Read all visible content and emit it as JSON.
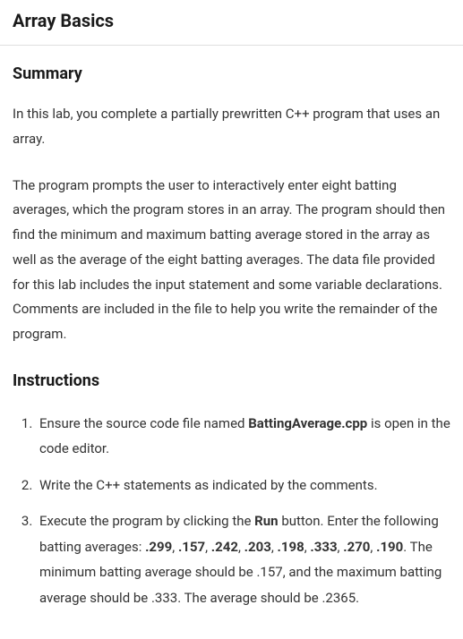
{
  "title": "Array Basics",
  "summary": {
    "heading": "Summary",
    "para1": "In this lab, you complete a partially prewritten C++ program that uses an array.",
    "para2": "The program prompts the user to interactively enter eight batting averages, which the program stores in an array. The program should then find the minimum and maximum batting average stored in the array as well as the average of the eight batting averages. The data file provided for this lab includes the input statement and some variable declarations. Comments are included in the file to help you write the remainder of the program."
  },
  "instructions": {
    "heading": "Instructions",
    "items": [
      {
        "pre": "Ensure the source code file named ",
        "bold1": "BattingAverage.cpp",
        "post": " is open in the code editor."
      },
      {
        "text": "Write the C++ statements as indicated by the comments."
      },
      {
        "pre": "Execute the program by clicking the ",
        "bold_run": "Run",
        "mid1": " button. Enter the following batting averages: ",
        "v1": ".299",
        "c": ", ",
        "v2": ".157",
        "v3": ".242",
        "v4": ".203",
        "v5": ".198",
        "v6": ".333",
        "v7": ".270",
        "v8": ".190",
        "post": ". The minimum batting average should be .157, and the maximum batting average should be .333. The average should be .2365."
      }
    ]
  }
}
